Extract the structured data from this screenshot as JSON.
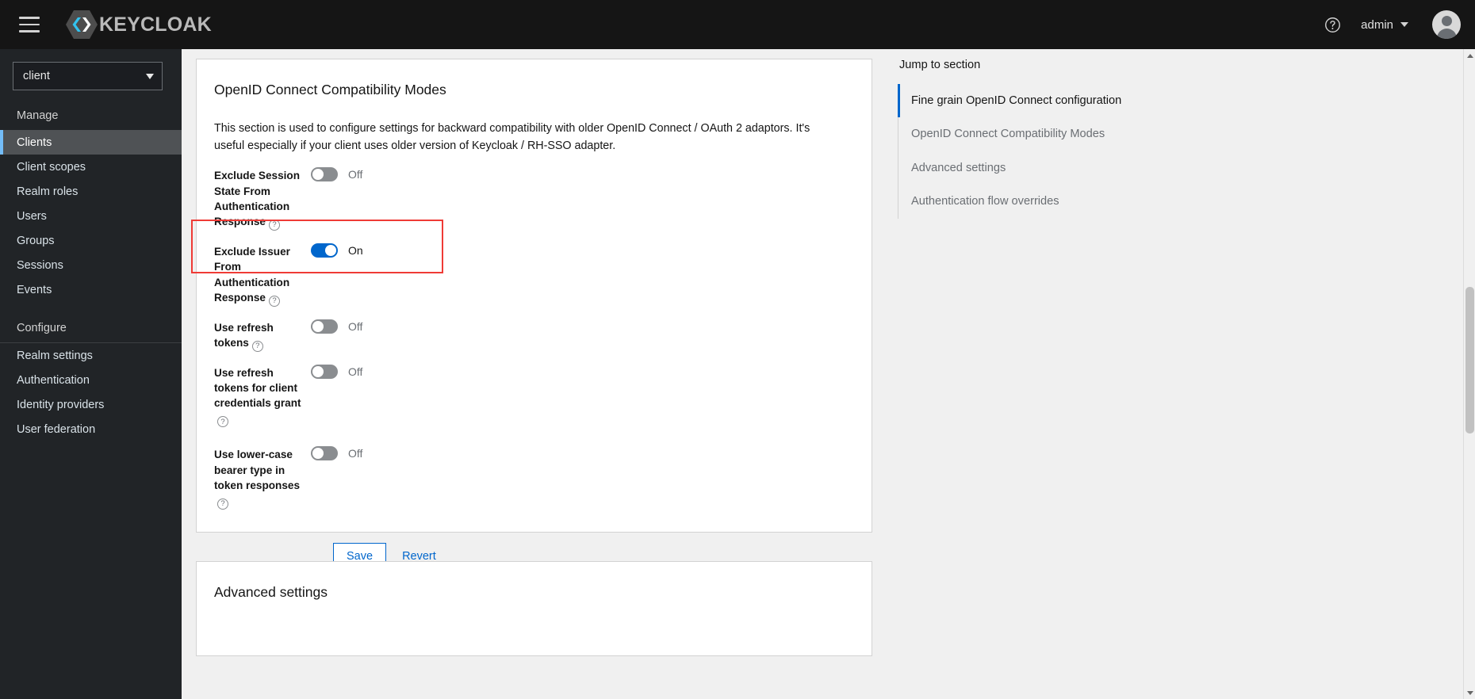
{
  "masthead": {
    "menu_icon": "hamburger-icon",
    "brand": "KEYCLOAK",
    "help_icon": "help-circle-icon",
    "user": "admin",
    "caret_icon": "chevron-down-icon",
    "avatar_icon": "user-avatar-icon"
  },
  "sidebar": {
    "realm_selector": {
      "value": "client",
      "caret_icon": "chevron-down-icon"
    },
    "groups": [
      {
        "title": "Manage",
        "items": [
          {
            "label": "Clients",
            "active": true
          },
          {
            "label": "Client scopes",
            "active": false
          },
          {
            "label": "Realm roles",
            "active": false
          },
          {
            "label": "Users",
            "active": false
          },
          {
            "label": "Groups",
            "active": false
          },
          {
            "label": "Sessions",
            "active": false
          },
          {
            "label": "Events",
            "active": false
          }
        ]
      },
      {
        "title": "Configure",
        "items": [
          {
            "label": "Realm settings",
            "active": false
          },
          {
            "label": "Authentication",
            "active": false
          },
          {
            "label": "Identity providers",
            "active": false
          },
          {
            "label": "User federation",
            "active": false
          }
        ]
      }
    ]
  },
  "main": {
    "oidc_card": {
      "title": "OpenID Connect Compatibility Modes",
      "description": "This section is used to configure settings for backward compatibility with older OpenID Connect / OAuth 2 adaptors. It's useful especially if your client uses older version of Keycloak / RH-SSO adapter.",
      "rows": [
        {
          "label": "Exclude Session State From Authentication Response",
          "help_icon": "help-circle-icon",
          "state": "Off",
          "on": false,
          "highlighted": false
        },
        {
          "label": "Exclude Issuer From Authentication Response",
          "help_icon": "help-circle-icon",
          "state": "On",
          "on": true,
          "highlighted": true
        },
        {
          "label": "Use refresh tokens",
          "help_icon": "help-circle-icon",
          "state": "Off",
          "on": false,
          "highlighted": false
        },
        {
          "label": "Use refresh tokens for client credentials grant",
          "help_icon": "help-circle-icon",
          "state": "Off",
          "on": false,
          "highlighted": false
        },
        {
          "label": "Use lower-case bearer type in token responses",
          "help_icon": "help-circle-icon",
          "state": "Off",
          "on": false,
          "highlighted": false
        }
      ],
      "save_label": "Save",
      "revert_label": "Revert"
    },
    "advanced_card": {
      "title": "Advanced settings"
    }
  },
  "jump_to_section": {
    "title": "Jump to section",
    "items": [
      {
        "label": "Fine grain OpenID Connect configuration",
        "active": true
      },
      {
        "label": "OpenID Connect Compatibility Modes",
        "active": false
      },
      {
        "label": "Advanced settings",
        "active": false
      },
      {
        "label": "Authentication flow overrides",
        "active": false
      }
    ]
  },
  "colors": {
    "accent_blue": "#0066cc",
    "highlight_red": "#ef3b36",
    "masthead_bg": "#151515",
    "sidebar_bg": "#212427",
    "brand_cyan": "#33c2ee"
  }
}
